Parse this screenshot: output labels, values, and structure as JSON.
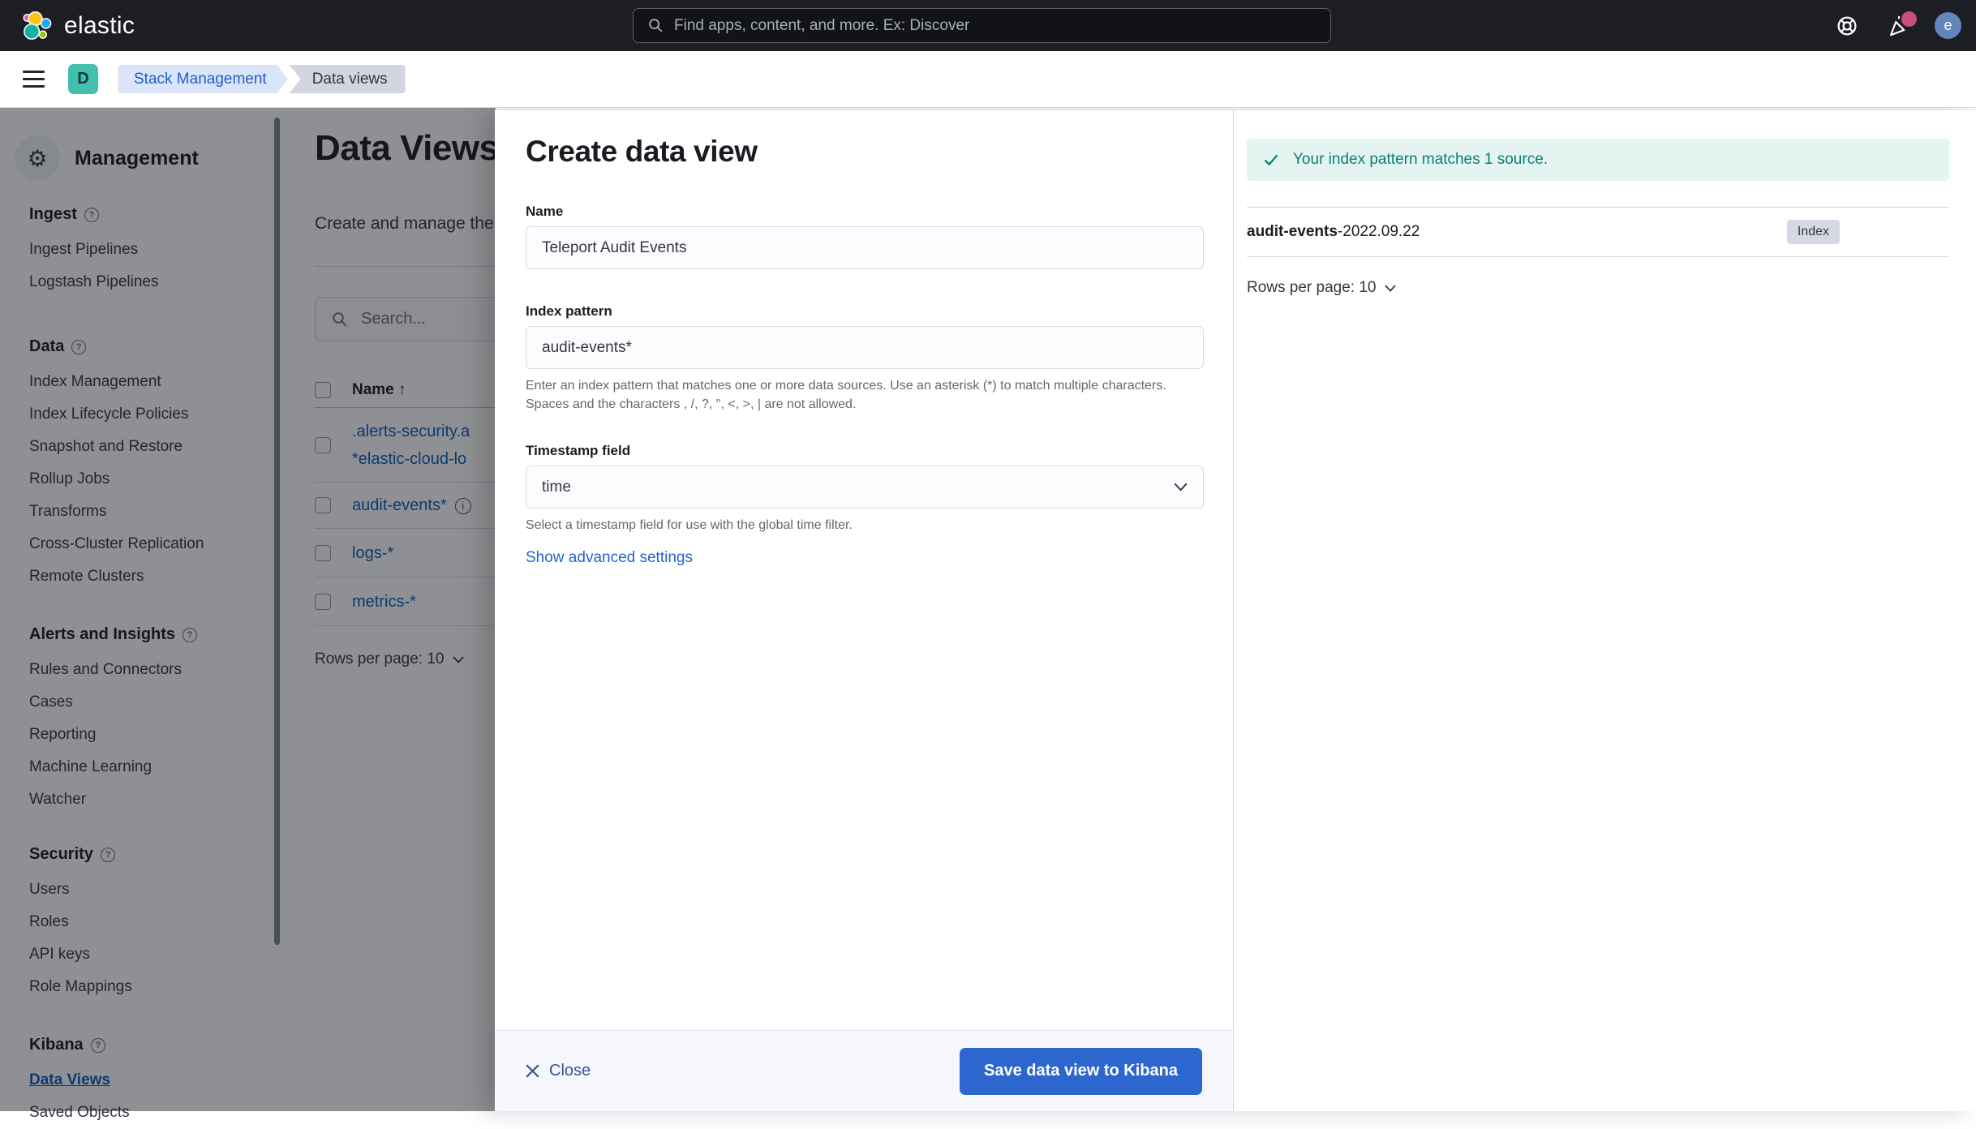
{
  "header": {
    "logo_text": "elastic",
    "search_placeholder": "Find apps, content, and more. Ex: Discover",
    "help_icon": "life-ring-help-icon",
    "news_icon": "newsfeed-cheer-icon",
    "avatar_initial": "e"
  },
  "breadcrumb": {
    "deployment_initial": "D",
    "crumbs": [
      "Stack Management",
      "Data views"
    ]
  },
  "sidebar": {
    "title": "Management",
    "groups": [
      {
        "label": "Ingest",
        "items": [
          {
            "label": "Ingest Pipelines"
          },
          {
            "label": "Logstash Pipelines"
          }
        ]
      },
      {
        "label": "Data",
        "items": [
          {
            "label": "Index Management"
          },
          {
            "label": "Index Lifecycle Policies"
          },
          {
            "label": "Snapshot and Restore"
          },
          {
            "label": "Rollup Jobs"
          },
          {
            "label": "Transforms"
          },
          {
            "label": "Cross-Cluster Replication"
          },
          {
            "label": "Remote Clusters"
          }
        ]
      },
      {
        "label": "Alerts and Insights",
        "items": [
          {
            "label": "Rules and Connectors"
          },
          {
            "label": "Cases"
          },
          {
            "label": "Reporting"
          },
          {
            "label": "Machine Learning"
          },
          {
            "label": "Watcher"
          }
        ]
      },
      {
        "label": "Security",
        "items": [
          {
            "label": "Users"
          },
          {
            "label": "Roles"
          },
          {
            "label": "API keys"
          },
          {
            "label": "Role Mappings"
          }
        ]
      },
      {
        "label": "Kibana",
        "items": [
          {
            "label": "Data Views",
            "active": true
          },
          {
            "label": "Saved Objects"
          }
        ]
      }
    ]
  },
  "main": {
    "title": "Data Views",
    "subtitle": "Create and manage the data views",
    "search_placeholder": "Search...",
    "table": {
      "name_header": "Name",
      "sort_arrow": "↑",
      "rows": [
        {
          "lines": [
            ".alerts-security.a",
            "*elastic-cloud-lo"
          ]
        },
        {
          "lines": [
            "audit-events*"
          ],
          "info": true
        },
        {
          "lines": [
            "logs-*"
          ]
        },
        {
          "lines": [
            "metrics-*"
          ]
        }
      ],
      "rows_per_page": "Rows per page: 10"
    }
  },
  "flyout": {
    "title": "Create data view",
    "name_label": "Name",
    "name_value": "Teleport Audit Events",
    "index_pattern_label": "Index pattern",
    "index_pattern_value": "audit-events*",
    "index_pattern_help": "Enter an index pattern that matches one or more data sources. Use an asterisk (*) to match multiple characters. Spaces and the characters , /, ?, \", <, >, | are not allowed.",
    "timestamp_label": "Timestamp field",
    "timestamp_value": "time",
    "timestamp_help": "Select a timestamp field for use with the global time filter.",
    "advanced_link": "Show advanced settings",
    "close_label": "Close",
    "save_label": "Save data view to Kibana"
  },
  "preview": {
    "callout": "Your index pattern matches 1 source.",
    "source_bold": "audit-events",
    "source_rest": "-2022.09.22",
    "badge": "Index",
    "rows_per_page": "Rows per page: 10"
  },
  "colors": {
    "primary_button": "#2e66d0",
    "success_text": "#0d7d74",
    "success_bg": "#e4f4f1",
    "header_bg": "#1d1e24",
    "deployment_badge": "#41c0ae",
    "link": "#0a5dbd",
    "badge_bg": "#d5d9e3"
  }
}
